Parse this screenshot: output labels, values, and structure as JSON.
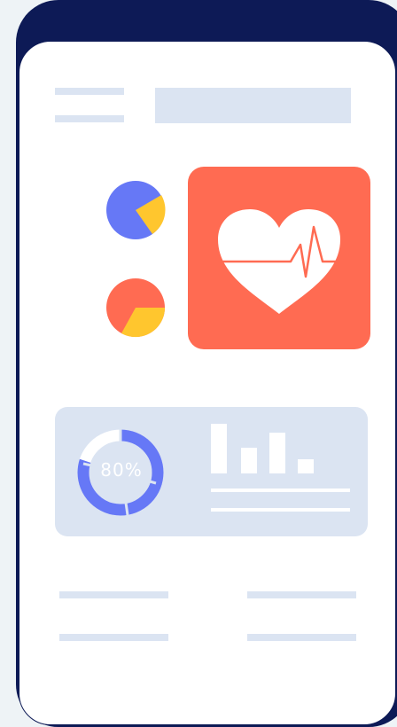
{
  "gauge": {
    "percent_label": "80%",
    "percent_value": 80
  },
  "colors": {
    "phone_frame": "#0d1a56",
    "screen_bg": "#ffffff",
    "placeholder": "#dbe4f2",
    "heart_card": "#ff6b52",
    "pie_blue": "#6678f6",
    "pie_orange": "#ff6b52",
    "pie_yellow": "#ffc62e",
    "gauge_blue": "#6678f6"
  },
  "icons": {
    "heart": "heart-pulse-icon",
    "pie_top": "pie-chart-icon",
    "pie_bottom": "pie-chart-icon",
    "bars": "bar-chart-icon",
    "gauge": "donut-gauge-icon"
  }
}
